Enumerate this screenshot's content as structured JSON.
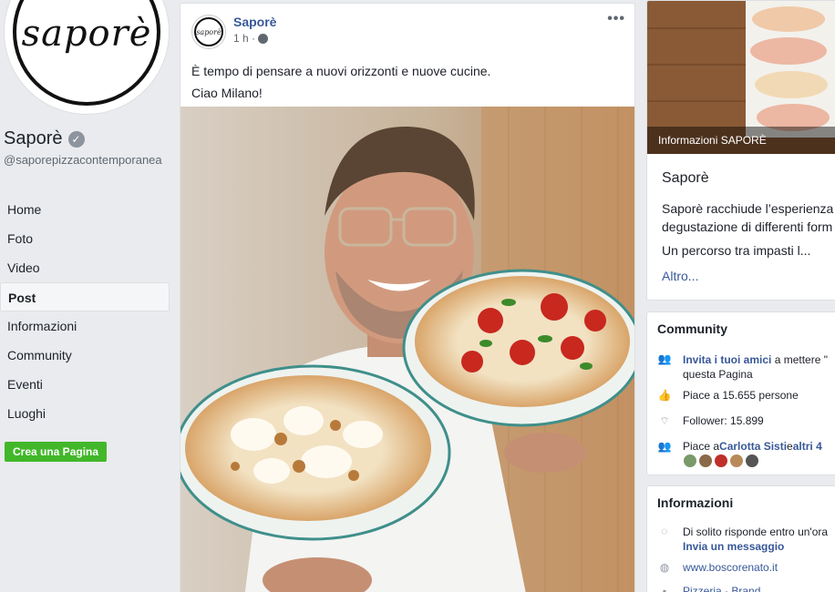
{
  "page": {
    "logo_text": "saporè",
    "name": "Saporè",
    "username": "@saporepizzacontemporanea"
  },
  "nav": {
    "items": [
      {
        "label": "Home"
      },
      {
        "label": "Foto"
      },
      {
        "label": "Video"
      },
      {
        "label": "Post"
      },
      {
        "label": "Informazioni"
      },
      {
        "label": "Community"
      },
      {
        "label": "Eventi"
      },
      {
        "label": "Luoghi"
      }
    ],
    "create_page": "Crea una Pagina"
  },
  "post": {
    "author": "Saporè",
    "time": "1 h ·",
    "line1": "È tempo di pensare a nuovi orizzonti e nuove cucine.",
    "line2": "Ciao Milano!",
    "more": "•••"
  },
  "about": {
    "image_label": "Informazioni SAPORÈ",
    "title": "Saporè",
    "desc_line1": "Saporè racchiude l’esperienza",
    "desc_line2": "degustazione di differenti form",
    "desc_line3": "Un percorso tra impasti l...",
    "more": "Altro..."
  },
  "community": {
    "title": "Community",
    "invite_link": "Invita i tuoi amici",
    "invite_rest": " a mettere \"",
    "invite_line2": "questa Pagina",
    "likes": "Piace a 15.655 persone",
    "followers": "Follower: 15.899",
    "friends_prefix": "Piace a ",
    "friend_name": "Carlotta Sisti",
    "friends_suffix": " e ",
    "friends_more": "altri 4"
  },
  "info": {
    "title": "Informazioni",
    "response": "Di solito risponde entro un'ora",
    "message": "Invia un messaggio",
    "website": "www.boscorenato.it",
    "category": "Pizzeria · Brand"
  },
  "colors": {
    "link": "#385898",
    "green": "#42b72a",
    "background": "#e9ebee"
  }
}
